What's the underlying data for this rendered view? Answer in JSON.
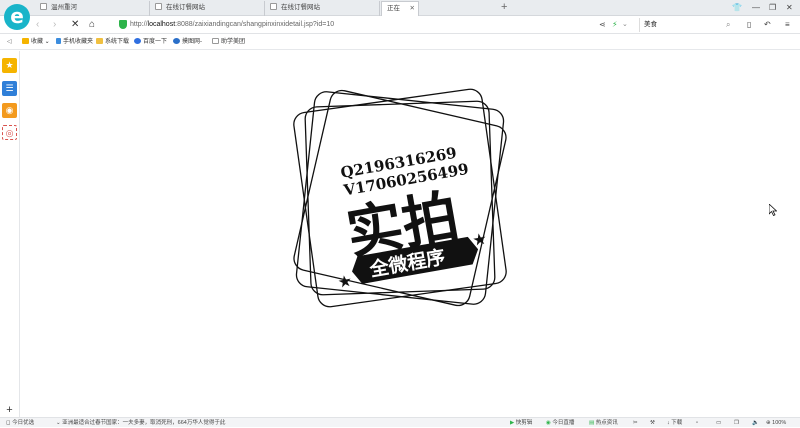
{
  "tabs": [
    {
      "title": "温州重河"
    },
    {
      "title": "在线订餐网站"
    },
    {
      "title": "在线订餐网站"
    },
    {
      "title": "正在"
    }
  ],
  "address": {
    "url_prefix": "http://",
    "url_host": "localhost",
    "url_rest": ":8088/zaixiandingcan/shangpinxinxidetail.jsp?id=10"
  },
  "search": {
    "value": "美食"
  },
  "bookmarks": [
    {
      "label": "收藏"
    },
    {
      "label": "手机收藏夹"
    },
    {
      "label": "系统下载"
    },
    {
      "label": "百度一下"
    },
    {
      "label": "摸图网-"
    },
    {
      "label": "助学美团"
    }
  ],
  "stamp": {
    "line1": "Q2196316269",
    "line2": "V17060256499",
    "main": "实拍",
    "banner": "全微程序"
  },
  "status": {
    "today_pick": "今日优选",
    "news": "亚洲最适合过春节国家：一夫多妻，取消死刑，664万华人觉得于此",
    "quick_cut": "快剪辑",
    "live": "今日直播",
    "hot_news": "热点资讯",
    "download": "下载",
    "zoom": "100%"
  },
  "colors": {
    "accent": "#19b4c9",
    "secure": "#2db34a"
  }
}
